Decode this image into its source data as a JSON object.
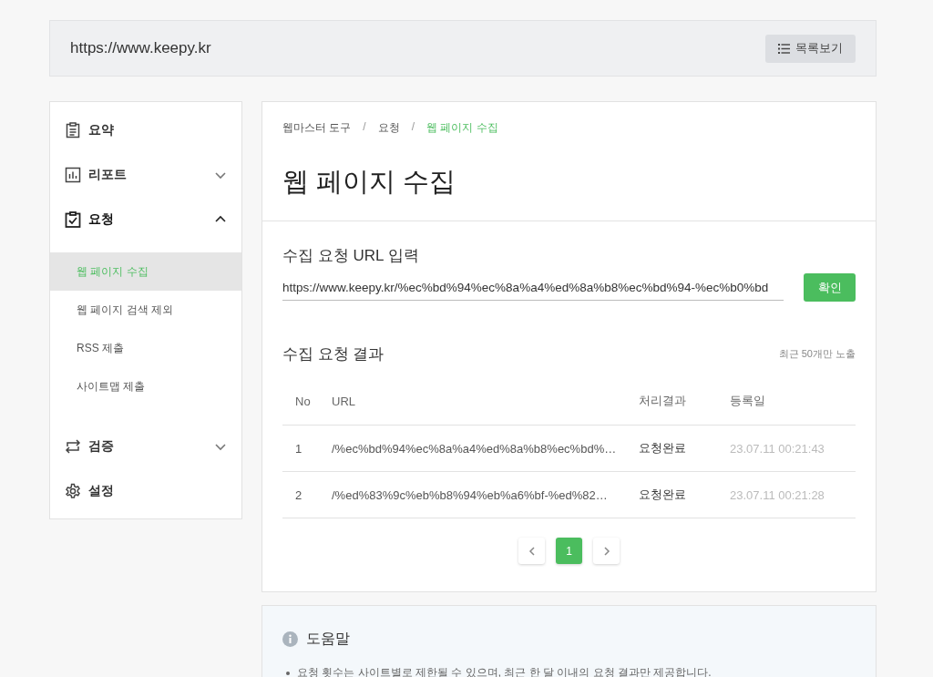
{
  "top_bar": {
    "site_url": "https://www.keepy.kr",
    "list_button": "목록보기"
  },
  "sidebar": {
    "items": [
      {
        "label": "요약",
        "selected": false
      },
      {
        "label": "리포트",
        "expanded": false,
        "selected": false
      },
      {
        "label": "요청",
        "expanded": true,
        "selected": true,
        "children": [
          {
            "label": "웹 페이지 수집",
            "selected": true
          },
          {
            "label": "웹 페이지 검색 제외",
            "selected": false
          },
          {
            "label": "RSS 제출",
            "selected": false
          },
          {
            "label": "사이트맵 제출",
            "selected": false
          }
        ]
      },
      {
        "label": "검증",
        "expanded": false,
        "selected": false
      },
      {
        "label": "설정",
        "selected": false
      }
    ]
  },
  "breadcrumb": [
    {
      "label": "웹마스터 도구",
      "current": false
    },
    {
      "label": "요청",
      "current": false
    },
    {
      "label": "웹 페이지 수집",
      "current": true
    }
  ],
  "separator": "/",
  "page_title": "웹 페이지 수집",
  "url_form": {
    "label": "수집 요청 URL 입력",
    "value": "https://www.keepy.kr/%ec%bd%94%ec%8a%a4%ed%8a%b8%ec%bd%94-%ec%b0%bd",
    "button": "확인"
  },
  "results": {
    "title": "수집 요청 결과",
    "note": "최근 50개만 노출",
    "table": {
      "columns": [
        "No",
        "URL",
        "처리결과",
        "등록일"
      ],
      "rows": [
        [
          "1",
          "/%ec%bd%94%ec%8a%a4%ed%8a%b8%ec%bd%…",
          "요청완료",
          "23.07.11 00:21:43"
        ],
        [
          "2",
          "/%ed%83%9c%eb%b8%94%eb%a6%bf-%ed%82…",
          "요청완료",
          "23.07.11 00:21:28"
        ]
      ]
    },
    "pagination": {
      "pages": [
        {
          "label": "1",
          "selected": true
        }
      ]
    }
  },
  "help": {
    "title": "도움말",
    "bullets": [
      "요청 횟수는 사이트별로 제한될 수 있으며, 최근 한 달 이내의 요청 결과만 제공합니다."
    ]
  }
}
